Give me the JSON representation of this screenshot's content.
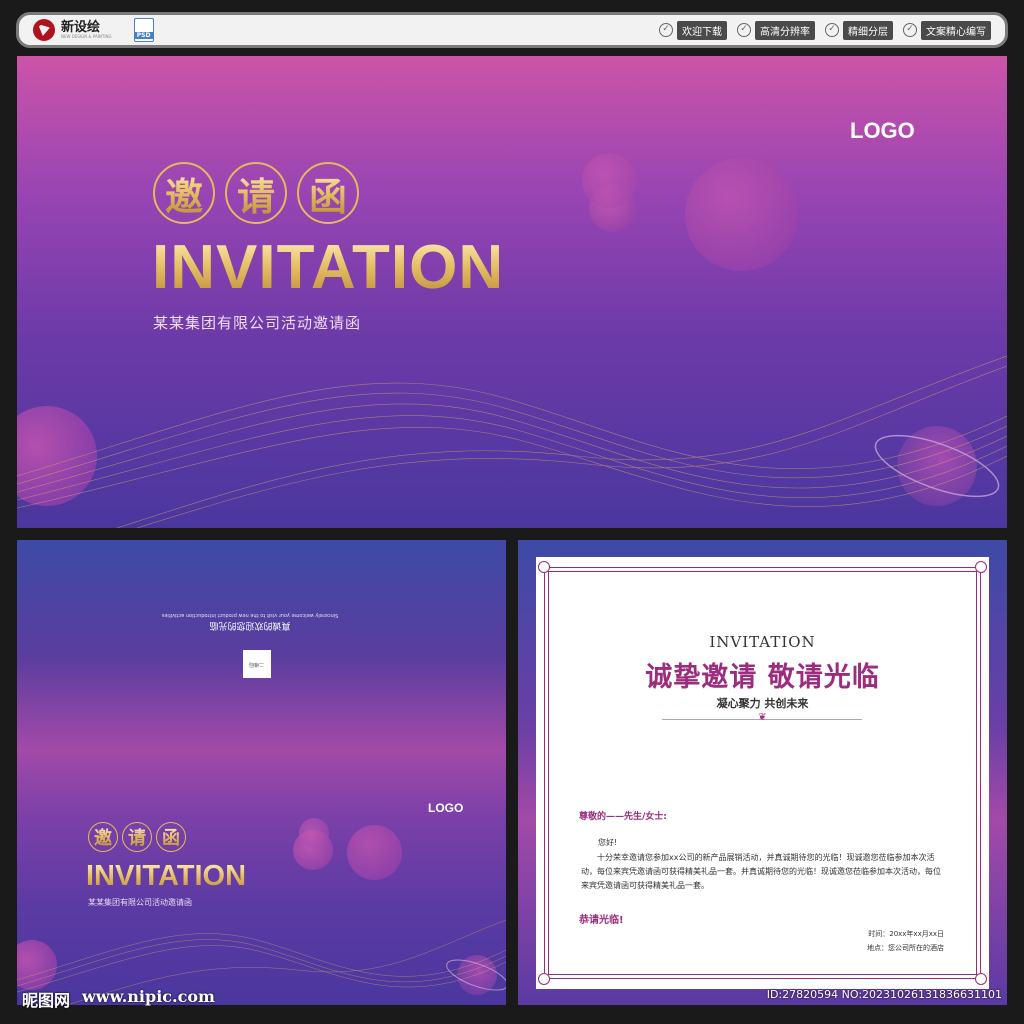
{
  "header": {
    "brand_name": "新设绘",
    "brand_sub": "NEW DESIGN & PAINTING",
    "file_type": "PSD",
    "badges": [
      {
        "label": "欢迎下载"
      },
      {
        "label": "高清分辨率"
      },
      {
        "label": "精细分层"
      },
      {
        "label": "文案精心编写"
      }
    ]
  },
  "banner": {
    "seal_chars": [
      "邀",
      "请",
      "函"
    ],
    "title": "INVITATION",
    "subtitle": "某某集团有限公司活动邀请函",
    "logo": "LOGO"
  },
  "back_panel": {
    "line1": "真诚的欢迎您的光临",
    "line2": "Sincerely welcome your visit to the new product introduction activities",
    "qr_label": "二维码",
    "logo": "LOGO",
    "seal_chars": [
      "邀",
      "请",
      "函"
    ],
    "title": "INVITATION",
    "subtitle": "某某集团有限公司活动邀请函"
  },
  "letter": {
    "eyebrow": "INVITATION",
    "title": "诚挚邀请  敬请光临",
    "tagline": "凝心聚力  共创未来",
    "greeting": "尊敬的——先生/女士:",
    "hello": "您好!",
    "body": "十分荣幸邀请您参加xx公司的新产品展销活动，并真诚期待您的光临！现诚邀您莅临参加本次活动，每位来宾凭邀请函可获得精美礼品一套。并真诚期待您的光临！现诚邀您莅临参加本次活动，每位来宾凭邀请函可获得精美礼品一套。",
    "closing": "恭请光临!",
    "time": "时间：20xx年xx月xx日",
    "place": "地点：您公司所在的酒店"
  },
  "watermark": {
    "site_cn": "昵图网",
    "site_url": "www.nipic.com",
    "id_text": "ID:27820594 NO:20231026131836631101"
  },
  "colors": {
    "gold": "#e3b95f",
    "accent": "#9b2c7e",
    "purple": "#6b3aa8",
    "pink": "#cc54a8"
  }
}
